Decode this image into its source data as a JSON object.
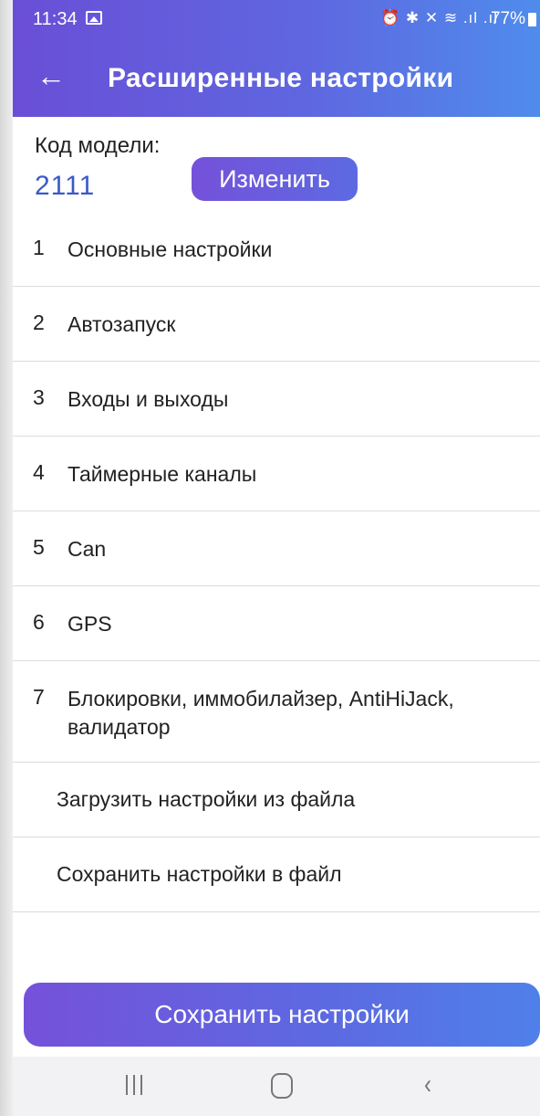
{
  "status_bar": {
    "time": "11:34",
    "icons": "⏰ ✱ ✕ ≋ .ıl .ıl",
    "battery": "77%"
  },
  "header": {
    "back_icon": "←",
    "title": "Расширенные настройки"
  },
  "model": {
    "label": "Код модели:",
    "value": "2111",
    "change_button": "Изменить"
  },
  "menu": {
    "items": [
      {
        "num": "1",
        "label": "Основные настройки"
      },
      {
        "num": "2",
        "label": "Автозапуск"
      },
      {
        "num": "3",
        "label": "Входы и выходы"
      },
      {
        "num": "4",
        "label": "Таймерные каналы"
      },
      {
        "num": "5",
        "label": "Can"
      },
      {
        "num": "6",
        "label": "GPS"
      },
      {
        "num": "7",
        "label": "Блокировки, иммобилайзер, AntiHiJack, валидатор"
      }
    ],
    "load_from_file": "Загрузить настройки из файла",
    "save_to_file": "Сохранить настройки в файл"
  },
  "save_button": "Сохранить настройки",
  "navigation": {
    "back_glyph": "‹"
  },
  "colors": {
    "accent_purple": "#6a4fd6",
    "accent_blue": "#4f8cec",
    "model_value": "#3b59c9"
  }
}
